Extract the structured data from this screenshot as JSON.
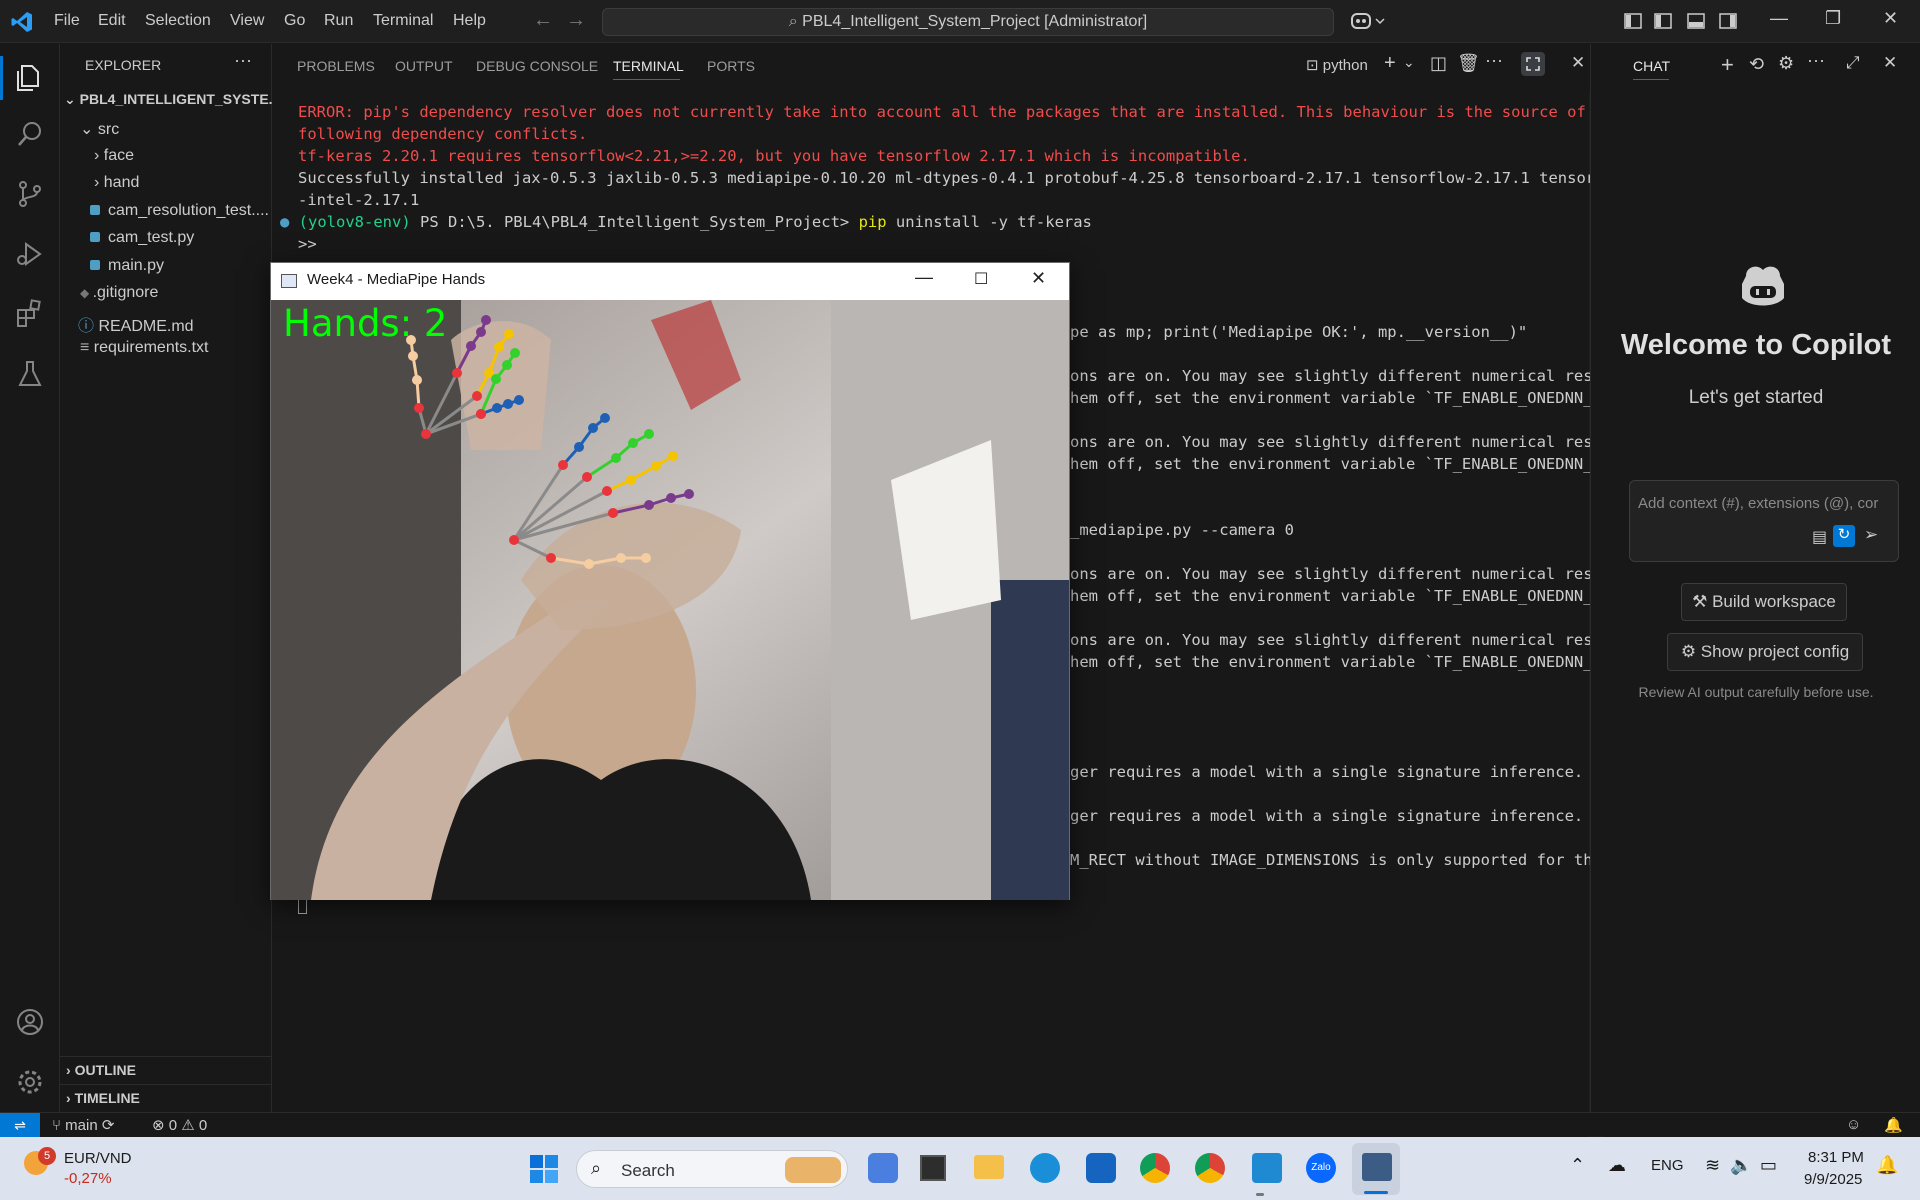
{
  "titlebar": {
    "menu": [
      "File",
      "Edit",
      "Selection",
      "View",
      "Go",
      "Run",
      "Terminal",
      "Help"
    ],
    "search_text": "PBL4_Intelligent_System_Project [Administrator]"
  },
  "sidebar": {
    "title": "EXPLORER",
    "root": "PBL4_INTELLIGENT_SYSTE...",
    "items": {
      "src": "src",
      "face": "face",
      "hand": "hand",
      "cam_res": "cam_resolution_test....",
      "cam_test": "cam_test.py",
      "main": "main.py",
      "gitignore": ".gitignore",
      "readme": "README.md",
      "requirements": "requirements.txt"
    },
    "outline": "OUTLINE",
    "timeline": "TIMELINE"
  },
  "panel": {
    "tabs": [
      "PROBLEMS",
      "OUTPUT",
      "DEBUG CONSOLE",
      "TERMINAL",
      "PORTS"
    ],
    "active_tab": "TERMINAL",
    "shell_label": "python"
  },
  "terminal": {
    "l1": "ERROR: pip's dependency resolver does not currently take into account all the packages that are installed. This behaviour is the source of the",
    "l2": "following dependency conflicts.",
    "l3": "tf-keras 2.20.1 requires tensorflow<2.21,>=2.20, but you have tensorflow 2.17.1 which is incompatible.",
    "l4": "Successfully installed jax-0.5.3 jaxlib-0.5.3 mediapipe-0.10.20 ml-dtypes-0.4.1 protobuf-4.25.8 tensorboard-2.17.1 tensorflow-2.17.1 tensorflow",
    "l5": "-intel-2.17.1",
    "prompt_env": "(yolov8-env)",
    "prompt_path": " PS D:\\5. PBL4\\PBL4_Intelligent_System_Project> ",
    "prompt_cmd": "pip",
    "prompt_args": " uninstall -y tf-keras",
    "l7": ">>",
    "r1": "pe as mp; print('Mediapipe OK:', mp.__version__)\"",
    "r2": "ons are on. You may see slightly different numerical resul",
    "r3": "hem off, set the environment variable `TF_ENABLE_ONEDNN_O",
    "r4": "ons are on. You may see slightly different numerical resul",
    "r5": "hem off, set the environment variable `TF_ENABLE_ONEDNN_O",
    "r6": "_mediapipe.py --camera 0",
    "r7": "ons are on. You may see slightly different numerical resul",
    "r8": "hem off, set the environment variable `TF_ENABLE_ONEDNN_O",
    "r9": "ons are on. You may see slightly different numerical resul",
    "r10": "hem off, set the environment variable `TF_ENABLE_ONEDNN_O",
    "r11": "ger requires a model with a single signature inference. D",
    "r12": "ger requires a model with a single signature inference. D",
    "r13": "M_RECT without IMAGE_DIMENSIONS is only supported for the"
  },
  "chat": {
    "tab": "CHAT",
    "welcome": "Welcome to Copilot",
    "subtitle": "Let's get started",
    "input_placeholder": "Add context (#), extensions (@), cor",
    "build_btn": "Build workspace",
    "config_btn": "Show project config",
    "disclaimer": "Review AI output carefully before use."
  },
  "statusbar": {
    "branch": "main",
    "errors": "0",
    "warnings": "0"
  },
  "camwin": {
    "title": "Week4 - MediaPipe Hands",
    "overlay": "Hands: 2"
  },
  "taskbar": {
    "weather_badge": "5",
    "ticker": "EUR/VND",
    "ticker_change": "-0,27%",
    "search": "Search",
    "lang": "ENG",
    "time": "8:31 PM",
    "date": "9/9/2025"
  },
  "colors": {
    "accent": "#0078d4",
    "error": "#f14c4c",
    "env": "#23d18b",
    "cmd": "#e5e510",
    "landmark_red": "#e8343a",
    "hands_label": "#00ff00"
  }
}
